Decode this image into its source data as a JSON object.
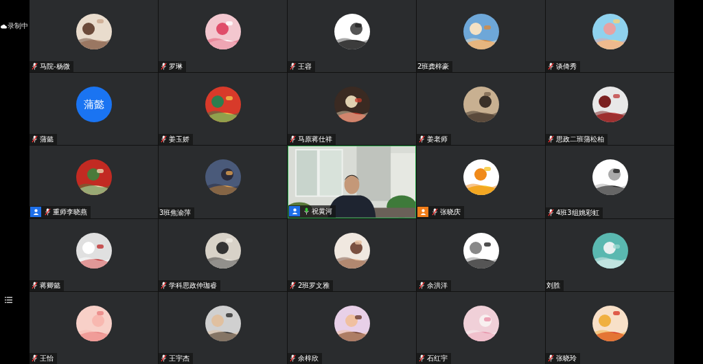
{
  "recording": {
    "label": "录制中"
  },
  "tiles": [
    {
      "kind": "picture",
      "name": "马院-杨微",
      "mic": {
        "muted": true
      },
      "active": false
    },
    {
      "kind": "picture",
      "name": "罗琳",
      "mic": {
        "muted": true
      },
      "active": false
    },
    {
      "kind": "picture",
      "name": "王容",
      "mic": {
        "muted": true
      },
      "active": false
    },
    {
      "kind": "picture",
      "name": "2班龚梓豪",
      "active": false
    },
    {
      "kind": "picture",
      "name": "谈倚秀",
      "mic": {
        "muted": true
      },
      "active": false
    },
    {
      "kind": "initials",
      "initials": "蒲懿",
      "name": "蒲懿",
      "mic": {
        "muted": true
      },
      "active": false
    },
    {
      "kind": "picture",
      "name": "姜玉娇",
      "mic": {
        "muted": true
      },
      "active": false
    },
    {
      "kind": "picture",
      "name": "马原蒋仕祥",
      "mic": {
        "muted": true
      },
      "active": false
    },
    {
      "kind": "picture",
      "name": "姜老师",
      "mic": {
        "muted": true
      },
      "active": false
    },
    {
      "kind": "picture",
      "name": "思政二班蒲松柏",
      "mic": {
        "muted": true
      },
      "active": false
    },
    {
      "kind": "picture",
      "name": "重师李晓燕",
      "mic": {
        "muted": true
      },
      "color": "#1e6fe8",
      "active": false
    },
    {
      "kind": "picture",
      "name": "3班焦渝萍",
      "active": false
    },
    {
      "kind": "video",
      "name": "祝黄河",
      "mic": {
        "muted": false
      },
      "color": "#1e6fe8",
      "active": true
    },
    {
      "kind": "picture",
      "name": "张晓庆",
      "mic": {
        "muted": true
      },
      "color": "#f07d1a",
      "active": false
    },
    {
      "kind": "picture",
      "name": "4班3组姚彩虹",
      "mic": {
        "muted": true
      },
      "active": false
    },
    {
      "kind": "picture",
      "name": "蒋卿懿",
      "mic": {
        "muted": true
      },
      "active": false
    },
    {
      "kind": "picture",
      "name": "学科思政仲珈睿",
      "mic": {
        "muted": true
      },
      "active": false
    },
    {
      "kind": "picture",
      "name": "2班罗文雅",
      "mic": {
        "muted": true
      },
      "active": false
    },
    {
      "kind": "picture",
      "name": "余洪洋",
      "mic": {
        "muted": true
      },
      "active": false
    },
    {
      "kind": "picture",
      "name": "刘胜",
      "active": false
    },
    {
      "kind": "picture",
      "name": "王怡",
      "mic": {
        "muted": true
      },
      "active": false
    },
    {
      "kind": "picture",
      "name": "王宇杰",
      "mic": {
        "muted": true
      },
      "active": false
    },
    {
      "kind": "picture",
      "name": "余梓欣",
      "mic": {
        "muted": true
      },
      "active": false
    },
    {
      "kind": "picture",
      "name": "石红宇",
      "mic": {
        "muted": true
      },
      "active": false
    },
    {
      "kind": "picture",
      "name": "张晓玲",
      "mic": {
        "muted": true
      },
      "active": false
    }
  ]
}
